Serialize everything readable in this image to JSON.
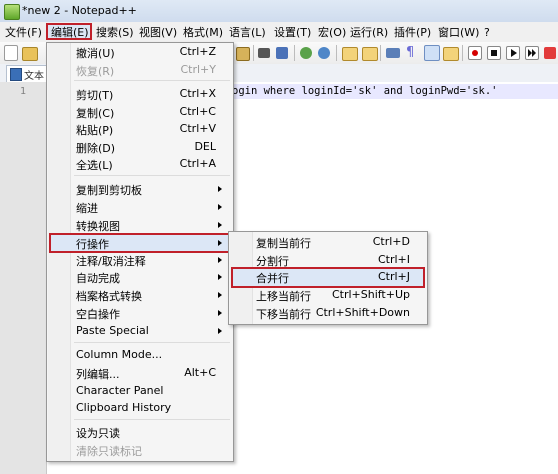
{
  "window": {
    "title": "*new  2 - Notepad++"
  },
  "menubar": [
    {
      "id": "file",
      "label": "文件(F)"
    },
    {
      "id": "edit",
      "label": "编辑(E)"
    },
    {
      "id": "search",
      "label": "搜索(S)"
    },
    {
      "id": "view",
      "label": "视图(V)"
    },
    {
      "id": "format",
      "label": "格式(M)"
    },
    {
      "id": "language",
      "label": "语言(L)"
    },
    {
      "id": "settings",
      "label": "设置(T)"
    },
    {
      "id": "macro",
      "label": "宏(O)"
    },
    {
      "id": "run",
      "label": "运行(R)"
    },
    {
      "id": "plugins",
      "label": "插件(P)"
    },
    {
      "id": "window",
      "label": "窗口(W)"
    },
    {
      "id": "help",
      "label": "?"
    }
  ],
  "tab": {
    "label": "文本"
  },
  "editor": {
    "line_number": "1",
    "code": "ogin where loginId='sk' and loginPwd='sk.'"
  },
  "edit_menu": {
    "items": [
      {
        "label": "撤消(U)",
        "shortcut": "Ctrl+Z",
        "disabled": false,
        "submenu": false
      },
      {
        "label": "恢复(R)",
        "shortcut": "Ctrl+Y",
        "disabled": true,
        "submenu": false
      },
      {
        "label": "剪切(T)",
        "shortcut": "Ctrl+X",
        "disabled": false,
        "submenu": false
      },
      {
        "label": "复制(C)",
        "shortcut": "Ctrl+C",
        "disabled": false,
        "submenu": false
      },
      {
        "label": "粘贴(P)",
        "shortcut": "Ctrl+V",
        "disabled": false,
        "submenu": false
      },
      {
        "label": "删除(D)",
        "shortcut": "DEL",
        "disabled": false,
        "submenu": false
      },
      {
        "label": "全选(L)",
        "shortcut": "Ctrl+A",
        "disabled": false,
        "submenu": false
      },
      {
        "label": "复制到剪切板",
        "shortcut": "",
        "disabled": false,
        "submenu": true
      },
      {
        "label": "缩进",
        "shortcut": "",
        "disabled": false,
        "submenu": true
      },
      {
        "label": "转换视图",
        "shortcut": "",
        "disabled": false,
        "submenu": true
      },
      {
        "label": "行操作",
        "shortcut": "",
        "disabled": false,
        "submenu": true
      },
      {
        "label": "注释/取消注释",
        "shortcut": "",
        "disabled": false,
        "submenu": true
      },
      {
        "label": "自动完成",
        "shortcut": "",
        "disabled": false,
        "submenu": true
      },
      {
        "label": "档案格式转换",
        "shortcut": "",
        "disabled": false,
        "submenu": true
      },
      {
        "label": "空白操作",
        "shortcut": "",
        "disabled": false,
        "submenu": true
      },
      {
        "label": "Paste Special",
        "shortcut": "",
        "disabled": false,
        "submenu": true
      },
      {
        "label": "Column Mode...",
        "shortcut": "",
        "disabled": false,
        "submenu": false
      },
      {
        "label": "列编辑...",
        "shortcut": "Alt+C",
        "disabled": false,
        "submenu": false
      },
      {
        "label": "Character Panel",
        "shortcut": "",
        "disabled": false,
        "submenu": false
      },
      {
        "label": "Clipboard History",
        "shortcut": "",
        "disabled": false,
        "submenu": false
      },
      {
        "label": "设为只读",
        "shortcut": "",
        "disabled": false,
        "submenu": false
      },
      {
        "label": "清除只读标记",
        "shortcut": "",
        "disabled": true,
        "submenu": false
      }
    ]
  },
  "line_ops_submenu": {
    "items": [
      {
        "label": "复制当前行",
        "shortcut": "Ctrl+D"
      },
      {
        "label": "分割行",
        "shortcut": "Ctrl+I"
      },
      {
        "label": "合并行",
        "shortcut": "Ctrl+J"
      },
      {
        "label": "上移当前行",
        "shortcut": "Ctrl+Shift+Up"
      },
      {
        "label": "下移当前行",
        "shortcut": "Ctrl+Shift+Down"
      }
    ]
  },
  "colors": {
    "highlight_border": "#c0202a",
    "menu_bg": "#f5f5f5",
    "hover_bg": "#dce7f6"
  }
}
